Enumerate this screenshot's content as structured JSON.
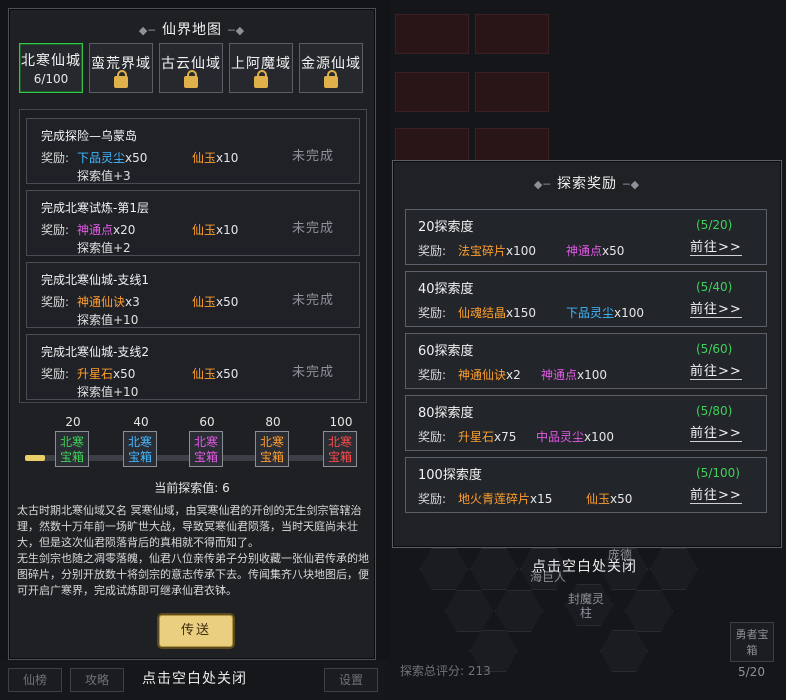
{
  "map": {
    "title": "仙界地图",
    "tabs": [
      {
        "name": "北寒仙城",
        "progress": "6/100",
        "locked": false
      },
      {
        "name": "蛮荒界域",
        "locked": true
      },
      {
        "name": "古云仙域",
        "locked": true
      },
      {
        "name": "上阿魔域",
        "locked": true
      },
      {
        "name": "金源仙域",
        "locked": true
      }
    ],
    "reward_label": "奖励:",
    "tasks": [
      {
        "title": "完成探险—乌蒙岛",
        "r1": "下品灵尘",
        "r1q": "x50",
        "r2": "仙玉",
        "r2q": "x10",
        "explore": "探索值+3",
        "status": "未完成"
      },
      {
        "title": "完成北寒试炼-第1层",
        "r1": "神通点",
        "r1q": "x20",
        "r2": "仙玉",
        "r2q": "x10",
        "explore": "探索值+2",
        "status": "未完成"
      },
      {
        "title": "完成北寒仙城-支线1",
        "r1": "神通仙诀",
        "r1q": "x3",
        "r2": "仙玉",
        "r2q": "x50",
        "explore": "探索值+10",
        "status": "未完成"
      },
      {
        "title": "完成北寒仙城-支线2",
        "r1": "升星石",
        "r1q": "x50",
        "r2": "仙玉",
        "r2q": "x50",
        "explore": "探索值+10",
        "status": "未完成"
      }
    ],
    "progress": {
      "current": 6,
      "max": 100,
      "milestones": [
        {
          "value": "20",
          "line1": "北寒",
          "line2": "宝箱",
          "color": "#3ed25a"
        },
        {
          "value": "40",
          "line1": "北寒",
          "line2": "宝箱",
          "color": "#43b8ff"
        },
        {
          "value": "60",
          "line1": "北寒",
          "line2": "宝箱",
          "color": "#e35ae6"
        },
        {
          "value": "80",
          "line1": "北寒",
          "line2": "宝箱",
          "color": "#ff9e2e"
        },
        {
          "value": "100",
          "line1": "北寒",
          "line2": "宝箱",
          "color": "#ff4a4a"
        }
      ],
      "current_label": "当前探索值: 6"
    },
    "lore_1": "太古时期北寒仙域又名 冥寒仙域，由冥寒仙君的开创的无生剑宗管辖治理，然数十万年前一场旷世大战，导致冥寒仙君陨落，当时天庭尚未壮大，但是这次仙君陨落背后的真相就不得而知了。",
    "lore_2": "无生剑宗也随之凋零落魄，仙君八位亲传弟子分别收藏一张仙君传承的地图碎片，分别开放数十将剑宗的意志传承下去。传闻集齐八块地图后，便可开启广寒界，完成试炼即可继承仙君衣钵。",
    "teleport_label": "传送",
    "close_hint": "点击空白处关闭"
  },
  "bottom_nav": {
    "left1": "仙榜",
    "left2": "攻略",
    "right": "设置"
  },
  "popup": {
    "title": "探索奖励",
    "reward_label": "奖励:",
    "goto_label": "前往>>",
    "rewards": [
      {
        "tier": "20探索度",
        "progress": "(5/20)",
        "i1": "法宝碎片",
        "i1q": "x100",
        "i2": "神通点",
        "i2q": "x50"
      },
      {
        "tier": "40探索度",
        "progress": "(5/40)",
        "i1": "仙魂结晶",
        "i1q": "x150",
        "i2": "下品灵尘",
        "i2q": "x100"
      },
      {
        "tier": "60探索度",
        "progress": "(5/60)",
        "i1": "神通仙诀",
        "i1q": "x2",
        "i2": "神通点",
        "i2q": "x100"
      },
      {
        "tier": "80探索度",
        "progress": "(5/80)",
        "i1": "升星石",
        "i1q": "x75",
        "i2": "中品灵尘",
        "i2q": "x100"
      },
      {
        "tier": "100探索度",
        "progress": "(5/100)",
        "i1": "地火青莲碎片",
        "i1q": "x15",
        "i2": "仙玉",
        "i2q": "x50"
      }
    ],
    "close_hint": "点击空白处关闭"
  },
  "background": {
    "score_label": "探索总评分: 213",
    "side_button": "勇者宝箱",
    "page": "5/20",
    "hex_labels": [
      "海巨人",
      "封魔灵柱",
      "庞德"
    ]
  }
}
